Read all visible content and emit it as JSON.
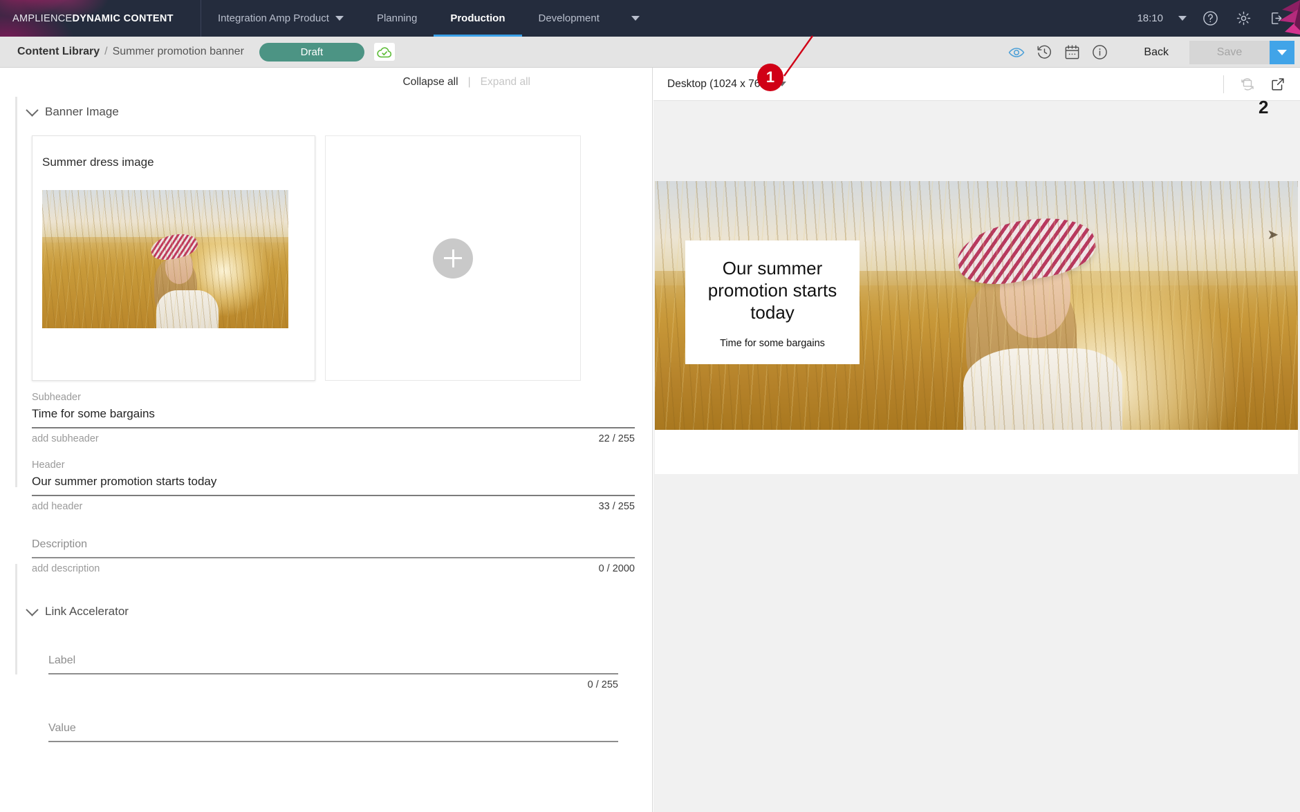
{
  "topbar": {
    "brand_light": "AMPLIENCE",
    "brand_bold": "DYNAMIC CONTENT",
    "nav": [
      {
        "label": "Integration Amp Product",
        "has_caret": true,
        "active": false
      },
      {
        "label": "Planning",
        "has_caret": false,
        "active": false
      },
      {
        "label": "Production",
        "has_caret": false,
        "active": true
      },
      {
        "label": "Development",
        "has_caret": false,
        "active": false
      }
    ],
    "clock": "18:10",
    "icons": [
      "help-icon",
      "gear-icon",
      "logout-icon"
    ]
  },
  "subbar": {
    "breadcrumb_root": "Content Library",
    "breadcrumb_sep": "/",
    "breadcrumb_current": "Summer promotion banner",
    "status_badge": "Draft",
    "back_label": "Back",
    "save_label": "Save"
  },
  "editor": {
    "collapse_all": "Collapse all",
    "pipe": "|",
    "expand_all": "Expand all",
    "sections": [
      {
        "title": "Banner Image"
      },
      {
        "title": "Link Accelerator"
      }
    ],
    "image_card": {
      "title": "Summer dress image"
    },
    "fields": [
      {
        "label": "Subheader",
        "value": "Time for some bargains",
        "hint": "add subheader",
        "count": "22 / 255"
      },
      {
        "label": "Header",
        "value": "Our summer promotion starts today",
        "hint": "add header",
        "count": "33 / 255"
      }
    ],
    "description_field": {
      "label": "Description",
      "hint": "add description",
      "count": "0 / 2000"
    },
    "link_accelerator": {
      "label_field": {
        "label": "Label",
        "count": "0 / 255"
      },
      "value_field": {
        "label": "Value"
      }
    }
  },
  "preview": {
    "device": "Desktop (1024 x 768)",
    "banner": {
      "headline": "Our summer promotion starts today",
      "subline": "Time for some bargains"
    }
  },
  "annotations": {
    "marker_1": "1",
    "marker_2": "2"
  },
  "colors": {
    "topbar_bg": "#242c3d",
    "accent_blue": "#41a4e8",
    "draft_green": "#4c9484",
    "annotation_red": "#d00016"
  }
}
